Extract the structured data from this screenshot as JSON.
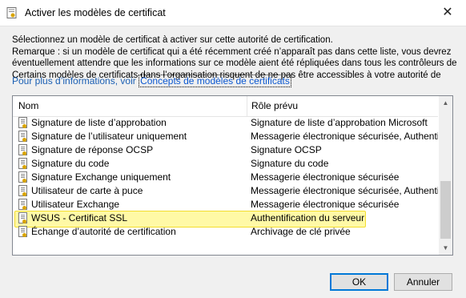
{
  "window": {
    "title": "Activer les modèles de certificat",
    "close_glyph": "✕"
  },
  "description": {
    "line1": "Sélectionnez un modèle de certificat à activer sur cette autorité de certification.",
    "line2": "Remarque : si un modèle de certificat qui a été récemment créé n’apparaît pas dans cette liste, vous devrez",
    "line3": "éventuellement attendre que les informations sur ce modèle aient été répliquées dans tous les contrôleurs de",
    "line4": "Certains modèles de certificats dans l’organisation risquent de ne pas être accessibles à votre autorité de",
    "link_prefix": "Pour plus d’informations, voir ",
    "link_text": "Concepts de modèles de certificats"
  },
  "list": {
    "columns": {
      "name": "Nom",
      "role": "Rôle prévu"
    },
    "rows": [
      {
        "name": "Signature de liste d’approbation",
        "role": "Signature de liste d’approbation Microsoft"
      },
      {
        "name": "Signature de l’utilisateur uniquement",
        "role": "Messagerie électronique sécurisée, Authentificati"
      },
      {
        "name": "Signature de réponse OCSP",
        "role": "Signature OCSP"
      },
      {
        "name": "Signature du code",
        "role": "Signature du code"
      },
      {
        "name": "Signature Exchange uniquement",
        "role": "Messagerie électronique sécurisée"
      },
      {
        "name": "Utilisateur de carte à puce",
        "role": "Messagerie électronique sécurisée, Authentificati"
      },
      {
        "name": "Utilisateur Exchange",
        "role": "Messagerie électronique sécurisée"
      },
      {
        "name": "WSUS - Certificat SSL",
        "role": "Authentification du serveur"
      },
      {
        "name": "Échange d’autorité de certification",
        "role": "Archivage de clé privée"
      }
    ],
    "highlighted_row": "WSUS - Certificat SSL",
    "highlight_color": "#fff9a6"
  },
  "buttons": {
    "ok": "OK",
    "cancel": "Annuler"
  },
  "colors": {
    "accent": "#0078d7",
    "link": "#0b57d0"
  }
}
